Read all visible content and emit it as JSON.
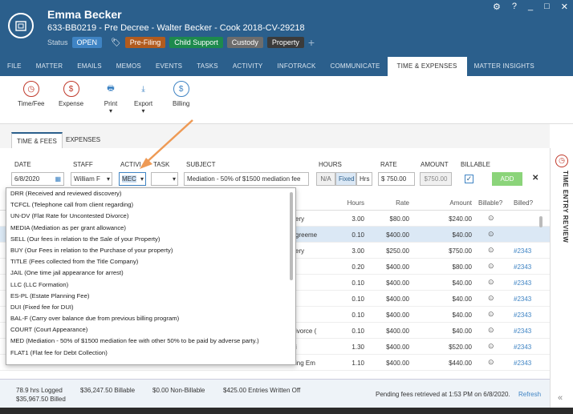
{
  "header": {
    "client_name": "Emma Becker",
    "case_line": "633-BB0219 - Pre Decree - Walter Becker - Cook 2018-CV-29218",
    "status_label": "Status",
    "status_value": "OPEN",
    "tags": [
      "Pre-Filing",
      "Child Support",
      "Custody",
      "Property"
    ],
    "add_tag": "+"
  },
  "window_controls": [
    "⚙",
    "?",
    "_",
    "□",
    "✕"
  ],
  "nav_tabs": [
    "FILE",
    "MATTER",
    "EMAILS",
    "MEMOS",
    "EVENTS",
    "TASKS",
    "ACTIVITY",
    "INFOTRACK",
    "COMMUNICATE",
    "TIME & EXPENSES",
    "MATTER INSIGHTS"
  ],
  "toolbar": {
    "time_fee": "Time/Fee",
    "expense": "Expense",
    "print": "Print",
    "export": "Export",
    "billing": "Billing"
  },
  "subtabs": [
    "TIME & FEES",
    "EXPENSES"
  ],
  "form": {
    "labels": {
      "date": "DATE",
      "staff": "STAFF",
      "activity": "ACTIVI...",
      "task": "TASK",
      "subject": "SUBJECT",
      "hours": "HOURS",
      "rate": "RATE",
      "amount": "AMOUNT",
      "billable": "BILLABLE"
    },
    "date": "6/8/2020",
    "staff": "William F",
    "activity": "MEC",
    "subject": "Mediation - 50% of $1500 mediation fee",
    "hours_modes": [
      "N/A",
      "Fixed",
      "Hrs"
    ],
    "rate": "$  750.00",
    "amount": "$750.00",
    "add_label": "ADD",
    "close": "✕"
  },
  "grid": {
    "headers": [
      "Hours",
      "Rate",
      "Amount",
      "Billable?",
      "Billed?"
    ],
    "rows": [
      {
        "subject": "ery",
        "hours": "3.00",
        "rate": "$80.00",
        "amount": "$240.00",
        "billed": ""
      },
      {
        "subject": "greeme",
        "hours": "0.10",
        "rate": "$400.00",
        "amount": "$40.00",
        "billed": ""
      },
      {
        "subject": "ery",
        "hours": "3.00",
        "rate": "$250.00",
        "amount": "$750.00",
        "billed": "#2343"
      },
      {
        "subject": "",
        "hours": "0.20",
        "rate": "$400.00",
        "amount": "$80.00",
        "billed": "#2343"
      },
      {
        "subject": "",
        "hours": "0.10",
        "rate": "$400.00",
        "amount": "$40.00",
        "billed": "#2343"
      },
      {
        "subject": "",
        "hours": "0.10",
        "rate": "$400.00",
        "amount": "$40.00",
        "billed": "#2343"
      },
      {
        "subject": "",
        "hours": "0.10",
        "rate": "$400.00",
        "amount": "$40.00",
        "billed": "#2343"
      },
      {
        "subject": "ivorce (",
        "hours": "0.10",
        "rate": "$400.00",
        "amount": "$40.00",
        "billed": "#2343"
      },
      {
        "subject": "i",
        "hours": "1.30",
        "rate": "$400.00",
        "amount": "$520.00",
        "billed": "#2343"
      },
      {
        "subject": "ing Em",
        "hours": "1.10",
        "wide": "",
        "rate": "$400.00",
        "amount": "$440.00",
        "billed": "#2343"
      }
    ]
  },
  "dropdown": [
    "DRR  (Received and reviewed discovery)",
    "TCFCL  (Telephone call from client regarding)",
    "UN-DV  (Flat Rate for Uncontested Divorce)",
    "MEDIA  (Mediation as per grant allowance)",
    "SELL  (Our fees in relation to the Sale of your Property)",
    "BUY  (Our Fees in relation to the Purchase of your property)",
    "TITLE  (Fees collected from the Title Company)",
    "JAIL  (One time jail appearance for arrest)",
    "LLC  (LLC Formation)",
    "ES-PL  (Estate Planning Fee)",
    "DUI  (Fixed fee for DUI)",
    "BAL-F  (Carry over balance due from previous billing program)",
    "COURT  (Court Appearance)",
    "MED  (Mediation - 50% of $1500 mediation fee with other 50% to be paid by adverse party.)",
    "FLAT1  (Flat fee for Debt Collection)"
  ],
  "footer": {
    "logged": "78.9 hrs Logged",
    "billed": "$35,967.50 Billed",
    "billable": "$36,247.50 Billable",
    "non_billable": "$0.00 Non-Billable",
    "written_off": "$425.00 Entries Written Off",
    "pending": "Pending fees retrieved at 1:53 PM on 6/8/2020.",
    "refresh": "Refresh"
  },
  "side_panel": {
    "label": "TIME ENTRY REVIEW",
    "collapse": "«"
  }
}
